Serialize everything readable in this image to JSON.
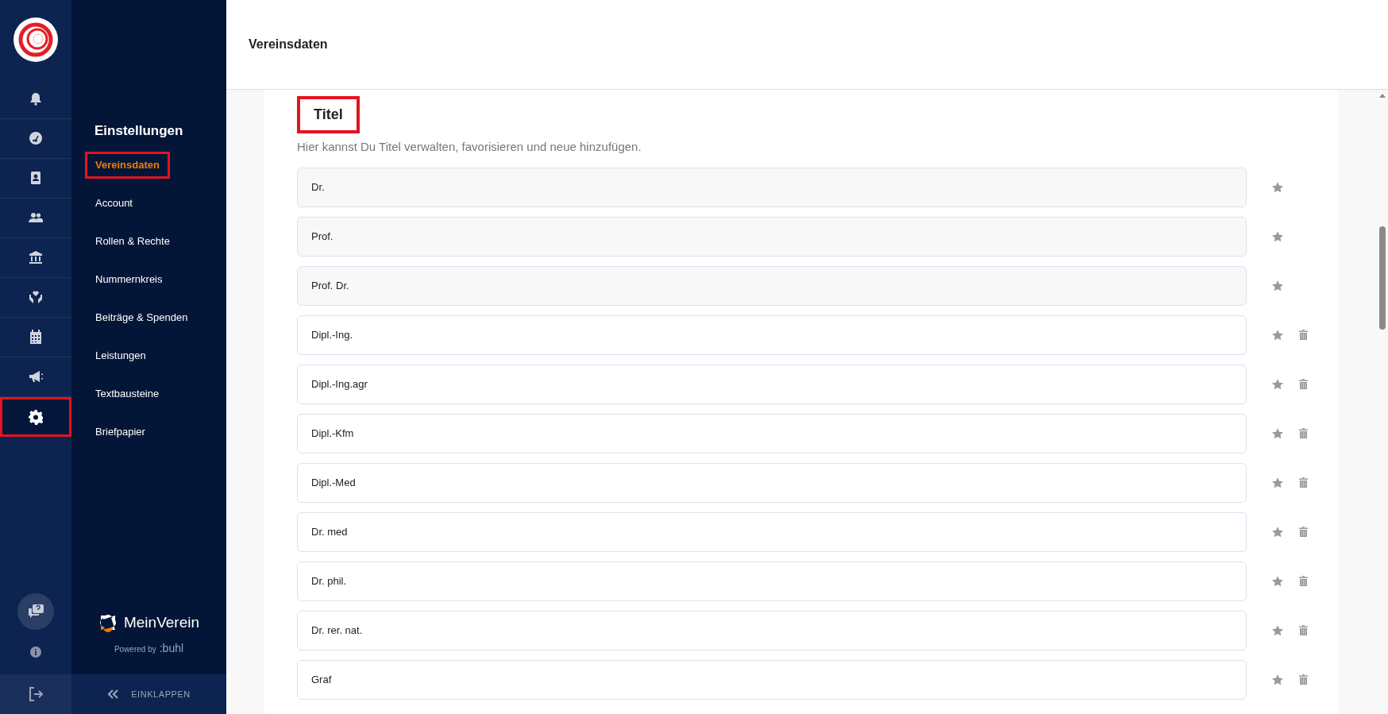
{
  "rail": {
    "items": [
      {
        "kind": "bell",
        "selected": false,
        "highlighted": false
      },
      {
        "kind": "gauge",
        "selected": false,
        "highlighted": false
      },
      {
        "kind": "contact",
        "selected": false,
        "highlighted": false
      },
      {
        "kind": "people",
        "selected": false,
        "highlighted": false
      },
      {
        "kind": "bank",
        "selected": false,
        "highlighted": false
      },
      {
        "kind": "donation",
        "selected": false,
        "highlighted": false
      },
      {
        "kind": "calendar",
        "selected": false,
        "highlighted": false
      },
      {
        "kind": "megaphone",
        "selected": false,
        "highlighted": false
      },
      {
        "kind": "gear",
        "selected": true,
        "highlighted": true
      }
    ]
  },
  "sidebar": {
    "heading": "Einstellungen",
    "items": [
      {
        "label": "Vereinsdaten",
        "selected": true,
        "highlighted": true
      },
      {
        "label": "Account",
        "selected": false,
        "highlighted": false
      },
      {
        "label": "Rollen & Rechte",
        "selected": false,
        "highlighted": false
      },
      {
        "label": "Nummernkreis",
        "selected": false,
        "highlighted": false
      },
      {
        "label": "Beiträge & Spenden",
        "selected": false,
        "highlighted": false
      },
      {
        "label": "Leistungen",
        "selected": false,
        "highlighted": false
      },
      {
        "label": "Textbausteine",
        "selected": false,
        "highlighted": false
      },
      {
        "label": "Briefpapier",
        "selected": false,
        "highlighted": false
      }
    ],
    "brand": "MeinVerein",
    "powered_by": "Powered by",
    "powered_brand": ":buhl",
    "collapse": "EINKLAPPEN"
  },
  "header": {
    "title": "Vereinsdaten"
  },
  "section": {
    "title": "Titel",
    "title_highlighted": true,
    "description": "Hier kannst Du Titel verwalten, favorisieren und neue hinzufügen.",
    "rows": [
      {
        "value": "Dr.",
        "kind": "default"
      },
      {
        "value": "Prof.",
        "kind": "default"
      },
      {
        "value": "Prof. Dr.",
        "kind": "default"
      },
      {
        "value": "Dipl.-Ing.",
        "kind": "custom"
      },
      {
        "value": "Dipl.-Ing.agr",
        "kind": "custom"
      },
      {
        "value": "Dipl.-Kfm",
        "kind": "custom"
      },
      {
        "value": "Dipl.-Med",
        "kind": "custom"
      },
      {
        "value": "Dr. med",
        "kind": "custom"
      },
      {
        "value": "Dr. phil.",
        "kind": "custom"
      },
      {
        "value": "Dr. rer. nat.",
        "kind": "custom"
      },
      {
        "value": "Graf",
        "kind": "custom"
      }
    ]
  }
}
